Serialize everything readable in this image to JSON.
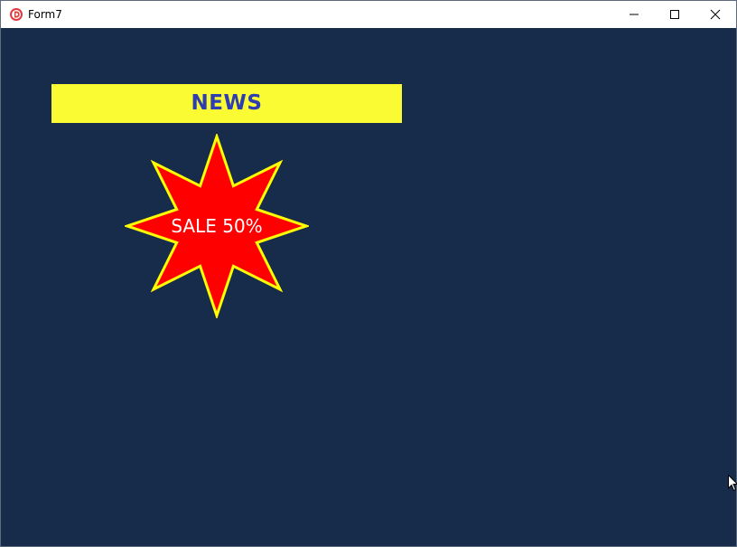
{
  "window": {
    "title": "Form7",
    "icon": "delphi-app-icon",
    "controls": {
      "minimize": "minimize-icon",
      "maximize": "maximize-icon",
      "close": "close-icon"
    }
  },
  "client": {
    "background": "#172b4b",
    "news_banner": {
      "label": "NEWS",
      "background": "#fbfb33",
      "text_color": "#2e3eb1"
    },
    "sale_star": {
      "label": "SALE 50%",
      "fill": "#ff0000",
      "stroke": "#ffff00",
      "text_color": "#ffffff",
      "points": 8
    }
  }
}
